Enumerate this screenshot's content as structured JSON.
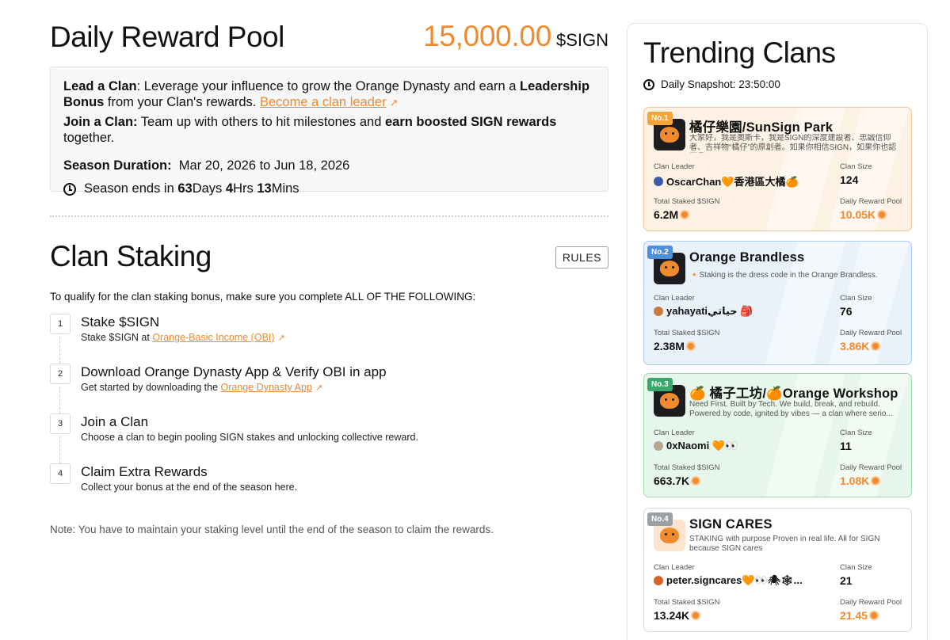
{
  "header": {
    "title": "Daily Reward Pool",
    "amount": "15,000.00",
    "unit": "$SIGN"
  },
  "info": {
    "lead_bold": "Lead a Clan",
    "lead_text": ": Leverage your influence to grow the Orange Dynasty and earn a ",
    "lead_bold2": "Leadership Bonus",
    "lead_text2": " from your Clan's rewards. ",
    "lead_link": "Become a clan leader",
    "join_bold": "Join a Clan:",
    "join_text": " Team up with others to hit milestones and ",
    "join_bold2": "earn boosted SIGN rewards",
    "join_text2": " together.",
    "season_label": "Season Duration:",
    "season_range": "Mar 20, 2026 to Jun 18, 2026",
    "ends_prefix": "Season ends in ",
    "ends_days": "63",
    "ends_days_label": " Days ",
    "ends_hrs": "4",
    "ends_hrs_label": " Hrs ",
    "ends_mins": "13",
    "ends_mins_label": " Mins"
  },
  "staking": {
    "title": "Clan Staking",
    "rules_label": "RULES",
    "qualify_text": "To qualify for the clan staking bonus, make sure you complete ALL OF THE FOLLOWING:",
    "steps": [
      {
        "num": "1",
        "title": "Stake $SIGN",
        "desc_prefix": "Stake $SIGN at ",
        "link": "Orange-Basic Income (OBI)",
        "desc_suffix": ""
      },
      {
        "num": "2",
        "title": "Download Orange Dynasty App & Verify OBI in app",
        "desc_prefix": "Get started by downloading the ",
        "link": "Orange Dynasty App",
        "desc_suffix": ""
      },
      {
        "num": "3",
        "title": "Join a Clan",
        "desc_prefix": "Choose a clan to begin pooling SIGN stakes and unlocking collective reward.",
        "link": "",
        "desc_suffix": ""
      },
      {
        "num": "4",
        "title": "Claim Extra Rewards",
        "desc_prefix": "Collect your bonus at the end of the season here.",
        "link": "",
        "desc_suffix": ""
      }
    ],
    "note": "Note: You have to maintain your staking level until the end of the season to claim the rewards."
  },
  "trending": {
    "title": "Trending Clans",
    "snapshot": "Daily Snapshot: 23:50:00",
    "labels": {
      "leader": "Clan Leader",
      "size": "Clan Size",
      "staked": "Total Staked $SIGN",
      "pool": "Daily Reward Pool"
    },
    "clans": [
      {
        "rank": "No.1",
        "name": "橘仔樂園/SunSign Park",
        "desc": "大家好，我是奧斯卡，我是SIGN的深度建設者、忠誠信仰者、吉祥物“橘仔”的原創者。如果你相信SIGN，如果你也認同我...",
        "leader": "OscarChan🧡香港區大橘🍊",
        "size": "124",
        "staked": "6.2M",
        "pool": "10.05K"
      },
      {
        "rank": "No.2",
        "name": "Orange Brandless",
        "desc": "🔸Staking is the dress code in the Orange Brandless.",
        "leader": "yahayatiحياتي 🎒",
        "size": "76",
        "staked": "2.38M",
        "pool": "3.86K"
      },
      {
        "rank": "No.3",
        "name": "🍊 橘子工坊/🍊Orange Workshop",
        "desc": "Need First. Built by Tech. We build, break, and rebuild. Powered by code, ignited by vibes — a clan where serio...",
        "leader": "0xNaomi 🧡👀",
        "size": "11",
        "staked": "663.7K",
        "pool": "1.08K"
      },
      {
        "rank": "No.4",
        "name": "SIGN CARES",
        "desc": "STAKING with purpose Proven in real life. All for SIGN because SIGN cares",
        "leader": "peter.signcares🧡👀🕷🕸...",
        "size": "21",
        "staked": "13.24K",
        "pool": "21.45"
      }
    ]
  },
  "colors": {
    "accent": "#f08a2e",
    "card1_bg": "#fdf1e4",
    "card2_bg": "#e9f2fb",
    "card3_bg": "#e7f6ec",
    "card4_bg": "#ffffff"
  }
}
